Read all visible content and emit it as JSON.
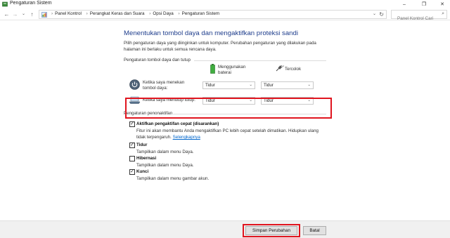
{
  "window": {
    "title": "Pengaturan Sistem",
    "minimize_glyph": "–",
    "maximize_glyph": "❐",
    "close_glyph": "✕"
  },
  "address_bar": {
    "back_glyph": "←",
    "forward_glyph": "→",
    "recent_glyph": "⌄",
    "up_glyph": "↑",
    "breadcrumbs": [
      "Panel Kontrol",
      "Perangkat Keras dan Suara",
      "Opsi Daya",
      "Pengaturan Sistem"
    ],
    "separator": "›",
    "dropdown_glyph": "⌄",
    "refresh_glyph": "↻",
    "search_placeholder": "Panel Kontrol Cari",
    "search_glyph": "⌕"
  },
  "main": {
    "title": "Menentukan tombol daya dan mengaktifkan proteksi sandi",
    "description": "Pilih pengaturan daya yang diinginkan untuk komputer. Perubahan pengaturan yang dilakukan pada halaman ini berlaku untuk semua rencana daya.",
    "power_section": {
      "heading": "Pengaturan tombol daya dan tutup",
      "col_battery": "Menggunakan baterai",
      "col_plugged": "Tercolok",
      "rows": [
        {
          "label": "Ketika saya menekan tombol daya:",
          "battery": "Tidur",
          "plugged": "Tidur"
        },
        {
          "label": "Ketika saya menutup tutup:",
          "battery": "Tidur",
          "plugged": "Tidur"
        }
      ],
      "select_arrow": "⌄"
    },
    "shutdown_section": {
      "heading": "Pengaturan penonaktifan",
      "check_glyph": "✓",
      "items": [
        {
          "label": "Aktifkan pengaktifan cepat (disarankan)",
          "checked": true,
          "desc": "Fitur ini akan membantu Anda mengaktifkan PC lebih cepat setelah dimatikan. Hidupkan ulang tidak terpengaruh.",
          "link": "Selengkapnya"
        },
        {
          "label": "Tidur",
          "checked": true,
          "desc": "Tampilkan dalam menu Daya."
        },
        {
          "label": "Hibernasi",
          "checked": false,
          "desc": "Tampilkan dalam menu Daya."
        },
        {
          "label": "Kunci",
          "checked": true,
          "desc": "Tampilkan dalam menu gambar akun."
        }
      ]
    }
  },
  "footer": {
    "save_label": "Simpan Perubahan",
    "cancel_label": "Batal"
  },
  "colors": {
    "title_blue": "#1e3d8c",
    "link_blue": "#0066cc",
    "highlight_red": "#e0151f"
  }
}
